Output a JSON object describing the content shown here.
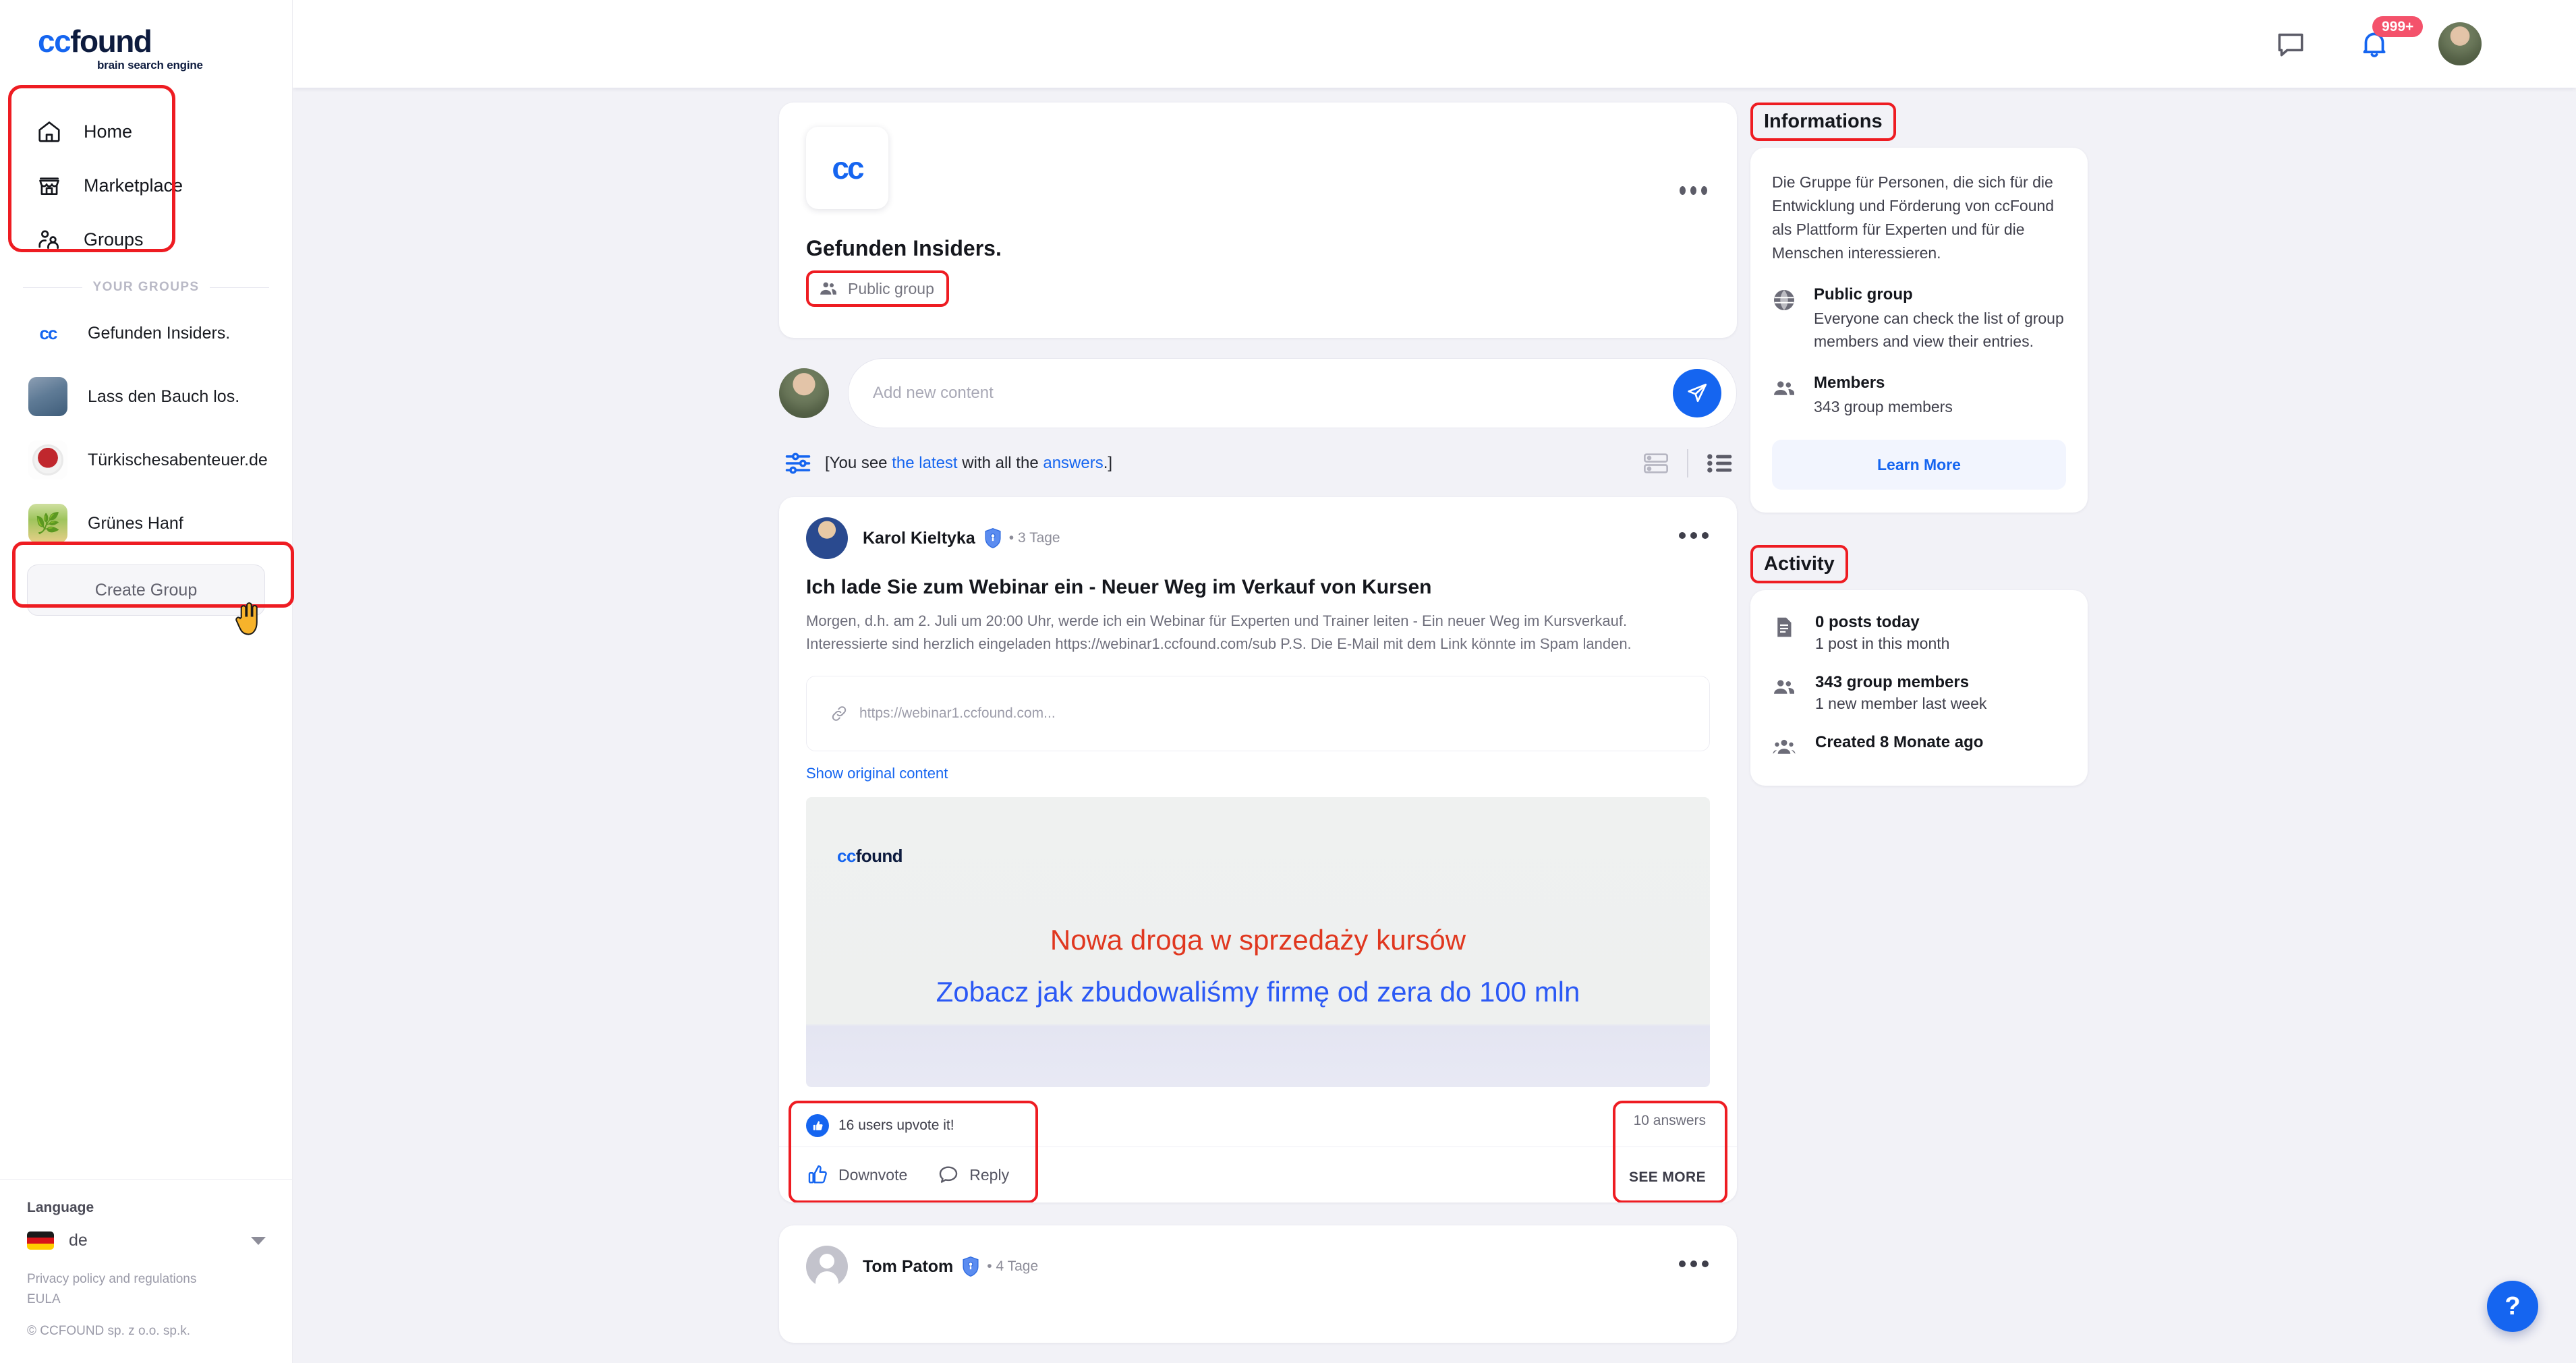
{
  "brand": {
    "name_cc": "cc",
    "name_found": "found",
    "tagline": "brain search engine"
  },
  "sidebar": {
    "nav": [
      {
        "label": "Home",
        "icon": "home-icon"
      },
      {
        "label": "Marketplace",
        "icon": "marketplace-icon"
      },
      {
        "label": "Groups",
        "icon": "groups-icon"
      }
    ],
    "section_label": "YOUR GROUPS",
    "groups": [
      {
        "name": "Gefunden Insiders.",
        "avatar": "cc-logo-avatar"
      },
      {
        "name": "Lass den Bauch los.",
        "avatar": "photo-avatar"
      },
      {
        "name": "Türkischesabenteuer.de",
        "avatar": "logo-avatar"
      },
      {
        "name": "Grünes Hanf",
        "avatar": "photo-avatar"
      }
    ],
    "create_group_label": "Create Group",
    "footer": {
      "language_label": "Language",
      "language_value": "de",
      "flag": "germany-flag",
      "privacy_link": "Privacy policy and regulations",
      "eula_link": "EULA",
      "copyright": "© CCFOUND sp. z o.o. sp.k."
    }
  },
  "topbar": {
    "messages_icon": "chat-bubble-icon",
    "notifications_icon": "bell-icon",
    "notifications_badge": "999+",
    "avatar": "user-avatar"
  },
  "group": {
    "logo_text": "cc",
    "name": "Gefunden Insiders.",
    "privacy_badge": "Public group",
    "menu_icon": "more-options-icon"
  },
  "composer": {
    "placeholder": "Add new content",
    "value": "",
    "send_icon": "send-icon"
  },
  "filterbar": {
    "filter_icon": "filters-icon",
    "prefix": "[You see ",
    "link1": "the latest",
    "middle": " with all the ",
    "link2": "answers",
    "suffix": ".]",
    "view_card_icon": "card-view-icon",
    "view_list_icon": "list-view-icon"
  },
  "posts": [
    {
      "author": "Karol Kieltyka",
      "verified_icon": "verified-shield-icon",
      "time": "3 Tage",
      "title": "Ich lade Sie zum Webinar ein - Neuer Weg im Verkauf von Kursen",
      "body": "Morgen, d.h. am 2. Juli um 20:00 Uhr, werde ich ein Webinar für Experten und Trainer leiten - Ein neuer Weg im Kursverkauf. Interessierte sind herzlich eingeladen https://webinar1.ccfound.com/sub P.S. Die E-Mail mit dem Link könnte im Spam landen.",
      "link_preview": "https://webinar1.ccfound.com...",
      "link_icon": "link-icon",
      "show_original": "Show original content",
      "banner": {
        "logo_cc": "cc",
        "logo_found": "found",
        "line1": "Nowa droga w sprzedaży kursów",
        "line2": "Zobacz jak zbudowaliśmy firmę od zera do 100 mln",
        "line1_color": "#e0371f",
        "line2_color": "#2b59f5"
      },
      "upvote_text": "16 users upvote it!",
      "downvote_label": "Downvote",
      "reply_label": "Reply",
      "answers_count": "10 answers",
      "see_more": "SEE MORE"
    },
    {
      "author": "Tom Patom",
      "verified_icon": "verified-shield-icon",
      "time": "4 Tage"
    }
  ],
  "informations": {
    "title": "Informations",
    "description": "Die Gruppe für Personen, die sich für die Entwicklung und Förderung von ccFound als Plattform für Experten und für die Menschen interessieren.",
    "rows": [
      {
        "icon": "globe-icon",
        "heading": "Public group",
        "detail": "Everyone can check the list of group members and view their entries."
      },
      {
        "icon": "members-icon",
        "heading": "Members",
        "detail": "343 group members"
      }
    ],
    "learn_more": "Learn More"
  },
  "activity": {
    "title": "Activity",
    "rows": [
      {
        "icon": "document-icon",
        "heading": "0 posts today",
        "detail": "1 post in this month"
      },
      {
        "icon": "members-icon",
        "heading": "343 group members",
        "detail": "1 new member last week"
      },
      {
        "icon": "group-created-icon",
        "heading": "Created 8 Monate ago",
        "detail": ""
      }
    ]
  },
  "help": {
    "label": "?",
    "icon": "help-icon"
  },
  "colors": {
    "accent": "#1565f0",
    "highlight": "#ee1c22",
    "badge": "#f4526b",
    "bg": "#f2f2f7"
  }
}
